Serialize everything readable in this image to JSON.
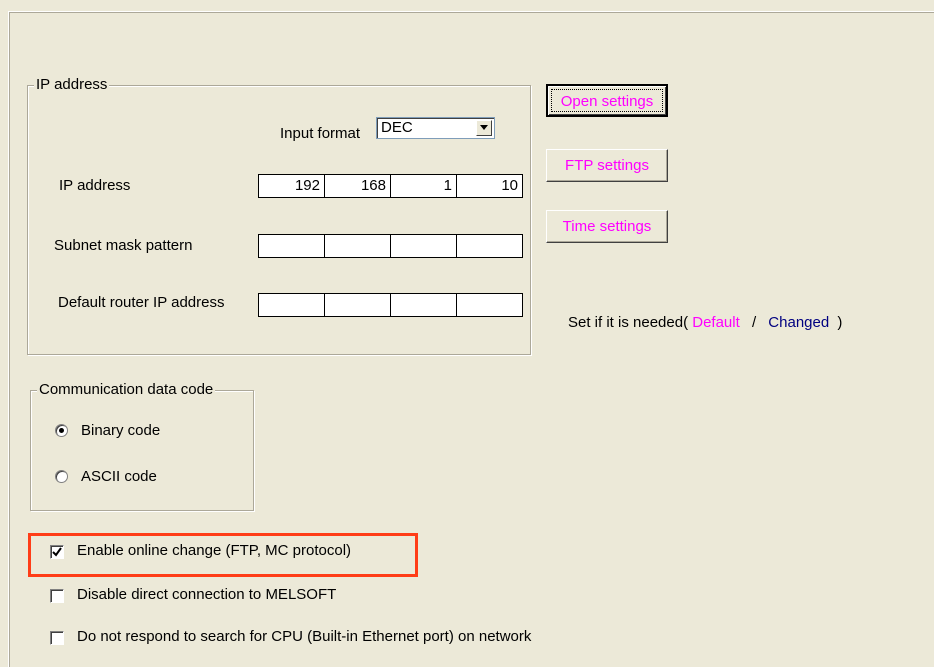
{
  "ip_group": {
    "legend": "IP address",
    "input_format_label": "Input format",
    "input_format_value": "DEC",
    "ip_address_label": "IP address",
    "ip_address": [
      "192",
      "168",
      "1",
      "10"
    ],
    "subnet_label": "Subnet mask pattern",
    "subnet": [
      "",
      "",
      "",
      ""
    ],
    "router_label": "Default router IP address",
    "router": [
      "",
      "",
      "",
      ""
    ]
  },
  "buttons": {
    "open_settings": "Open settings",
    "ftp_settings": "FTP settings",
    "time_settings": "Time settings"
  },
  "hint": {
    "prefix": "Set if it is needed(",
    "default": "Default",
    "slash": "/",
    "changed": "Changed",
    "suffix": ")"
  },
  "comm_group": {
    "legend": "Communication data code",
    "binary": "Binary code",
    "ascii": "ASCII code",
    "selected": "Binary code"
  },
  "checkboxes": {
    "online_change": {
      "label": "Enable online change (FTP, MC protocol)",
      "checked": true
    },
    "disable_direct": {
      "label": "Disable direct connection to MELSOFT",
      "checked": false
    },
    "no_respond": {
      "label": "Do not respond to search for CPU (Built-in Ethernet port) on network",
      "checked": false
    }
  },
  "colors": {
    "default_text": "#ff00ff",
    "changed_text": "#000080",
    "highlight": "#ff3d17"
  }
}
